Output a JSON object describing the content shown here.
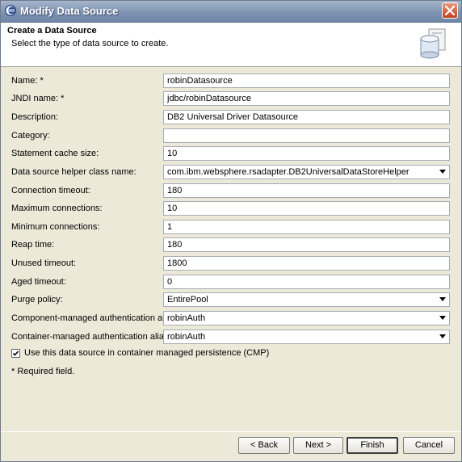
{
  "window": {
    "title": "Modify Data Source"
  },
  "header": {
    "title": "Create a Data Source",
    "description": "Select the type of data source to create."
  },
  "fields": [
    {
      "label": "Name: *",
      "value": "robinDatasource",
      "type": "text"
    },
    {
      "label": "JNDI name: *",
      "value": "jdbc/robinDatasource",
      "type": "text"
    },
    {
      "label": "Description:",
      "value": "DB2 Universal Driver Datasource",
      "type": "text"
    },
    {
      "label": "Category:",
      "value": "",
      "type": "text"
    },
    {
      "label": "Statement cache size:",
      "value": "10",
      "type": "text"
    },
    {
      "label": "Data source helper class name:",
      "value": "com.ibm.websphere.rsadapter.DB2UniversalDataStoreHelper",
      "type": "combo"
    },
    {
      "label": "Connection timeout:",
      "value": "180",
      "type": "text"
    },
    {
      "label": "Maximum connections:",
      "value": "10",
      "type": "text"
    },
    {
      "label": "Minimum connections:",
      "value": "1",
      "type": "text"
    },
    {
      "label": "Reap time:",
      "value": "180",
      "type": "text"
    },
    {
      "label": "Unused timeout:",
      "value": "1800",
      "type": "text"
    },
    {
      "label": "Aged timeout:",
      "value": "0",
      "type": "text"
    },
    {
      "label": "Purge policy:",
      "value": "EntirePool",
      "type": "combo"
    },
    {
      "label": "Component-managed authentication alias:",
      "value": "robinAuth",
      "type": "combo"
    },
    {
      "label": "Container-managed authentication alias:",
      "value": "robinAuth",
      "type": "combo"
    }
  ],
  "cmp_checkbox": {
    "label": "Use this data source in container managed persistence (CMP)",
    "checked": true
  },
  "required_note": "* Required field.",
  "buttons": {
    "back": "< Back",
    "next": "Next >",
    "finish": "Finish",
    "cancel": "Cancel"
  },
  "icons": {
    "title": "eclipse-icon",
    "close": "close-icon",
    "header": "database-icon"
  }
}
